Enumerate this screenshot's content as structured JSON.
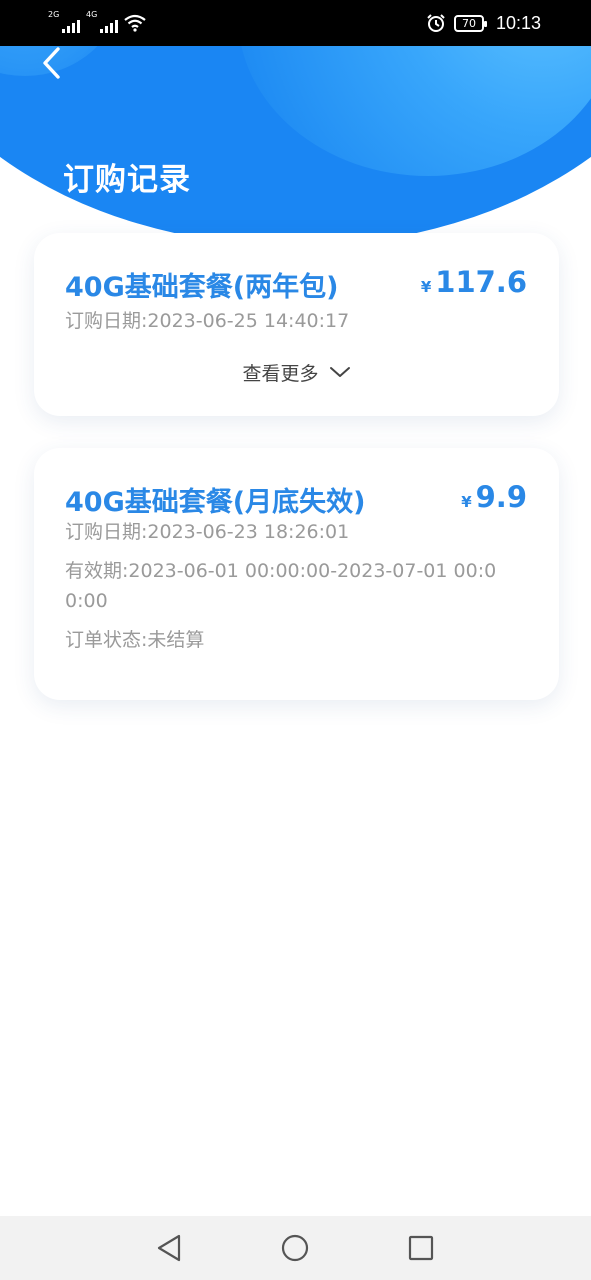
{
  "status_bar": {
    "signal_1_label": "2G",
    "signal_2_label": "4G",
    "battery": "70",
    "time": "10:13"
  },
  "header": {
    "title": "订购记录",
    "back_icon": "chevron-left-icon"
  },
  "orders": [
    {
      "name": "40G基础套餐(两年包)",
      "currency": "¥",
      "price": "117.6",
      "date_label": "订购日期:",
      "date": "2023-06-25 14:40:17",
      "more_label": "查看更多"
    },
    {
      "name": "40G基础套餐(月底失效)",
      "currency": "¥",
      "price": "9.9",
      "date_label": "订购日期:",
      "date": "2023-06-23 18:26:01",
      "valid_label": "有效期:",
      "valid": "2023-06-01 00:00:00-2023-07-01 00:00:00",
      "status_label": "订单状态:",
      "status": "未结算"
    }
  ],
  "colors": {
    "accent": "#2a88e6",
    "header_blue": "#1a86f3",
    "muted_text": "#9a9a9a"
  }
}
